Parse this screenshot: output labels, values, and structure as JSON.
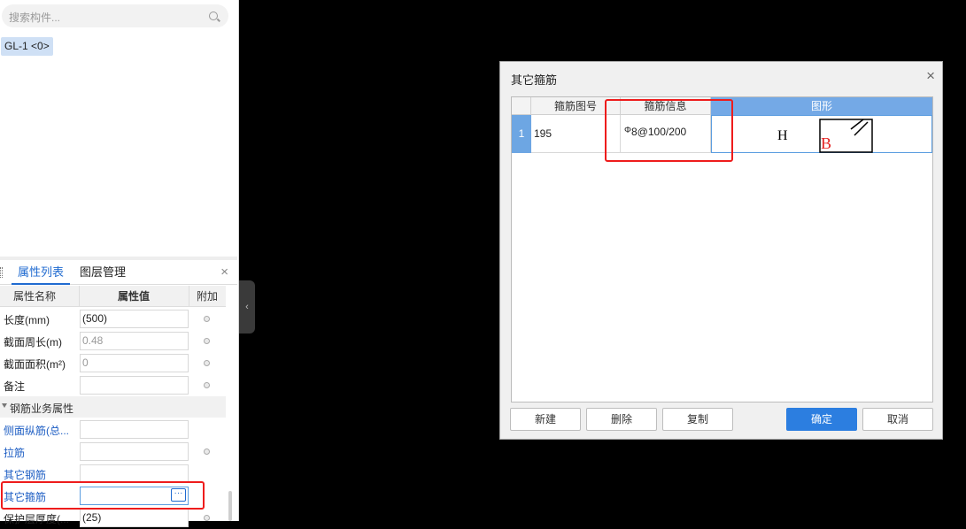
{
  "left_panel": {
    "search_placeholder": "搜索构件...",
    "component_tag": "GL-1 <0>",
    "tabs": [
      "属性列表",
      "图层管理"
    ],
    "close_glyph": "×",
    "headers": {
      "name": "属性名称",
      "value": "属性值",
      "extra": "附加"
    },
    "rows": [
      {
        "name": "长度(mm)",
        "value": "(500)"
      },
      {
        "name": "截面周长(m)",
        "value": "0.48"
      },
      {
        "name": "截面面积(m²)",
        "value": "0"
      },
      {
        "name": "备注",
        "value": ""
      }
    ],
    "group_label": "钢筋业务属性",
    "rebar_rows": [
      {
        "name": "侧面纵筋(总...",
        "value": ""
      },
      {
        "name": "拉筋",
        "value": ""
      },
      {
        "name": "其它钢筋",
        "value": ""
      },
      {
        "name": "其它箍筋",
        "value": ""
      },
      {
        "name": "保护层厚度(...",
        "value": "(25)"
      }
    ],
    "ellipsis": "···"
  },
  "collapse_glyph": "‹",
  "dialog": {
    "title": "其它箍筋",
    "close_glyph": "×",
    "columns": [
      "箍筋图号",
      "箍筋信息",
      "图形"
    ],
    "rows": [
      {
        "index": "1",
        "shape_no": "195",
        "info_symbol": "Φ",
        "info": "8@100/200",
        "label_h": "H",
        "label_b": "B"
      }
    ],
    "buttons": {
      "new": "新建",
      "delete": "删除",
      "copy": "复制",
      "ok": "确定",
      "cancel": "取消"
    }
  },
  "colors": {
    "accent": "#2c7ee0",
    "highlight": "#ee1c1c"
  }
}
